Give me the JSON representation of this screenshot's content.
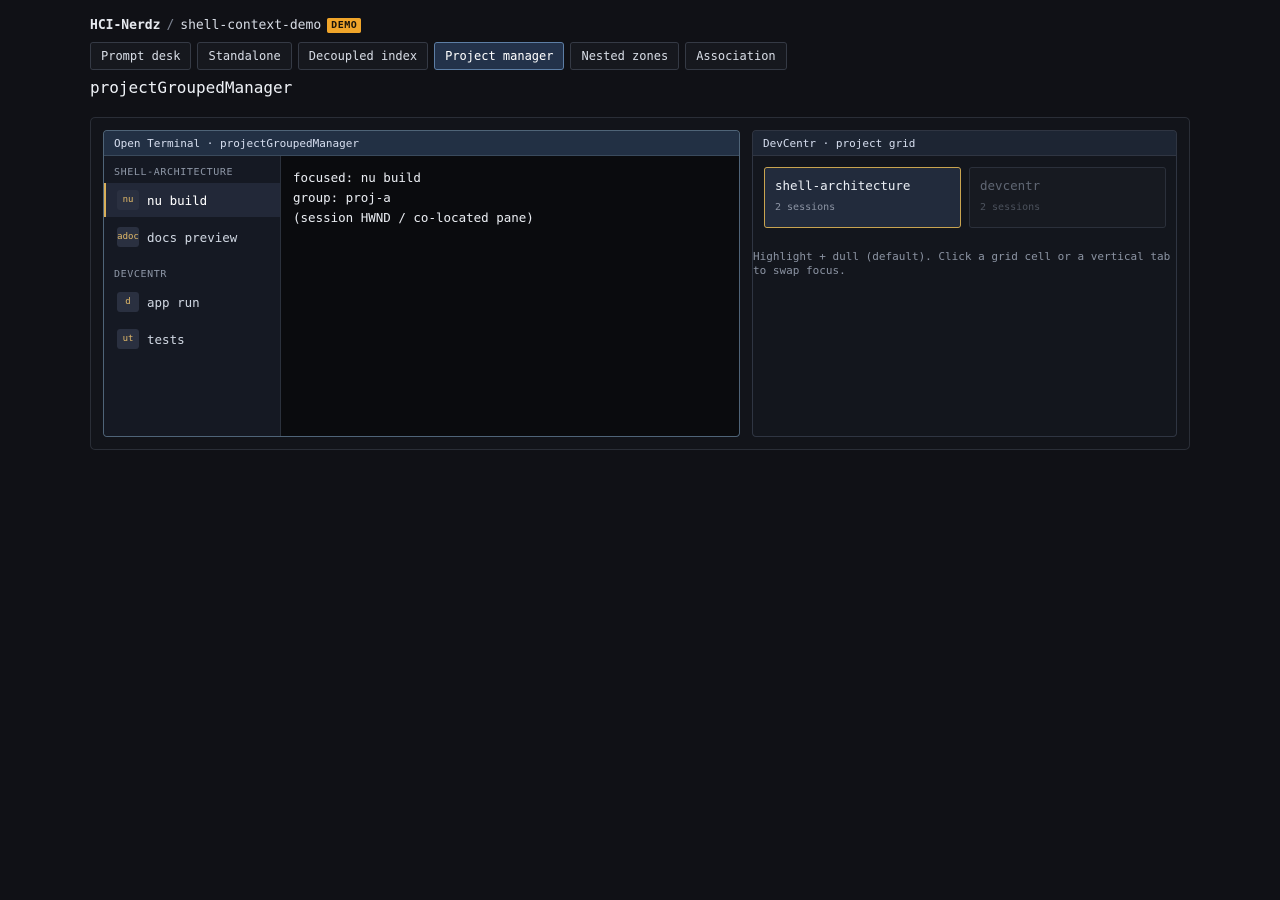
{
  "breadcrumb": {
    "org": "HCI-Nerdz",
    "separator": "/",
    "repo": "shell-context-demo",
    "badge": "DEMO"
  },
  "tabs": [
    {
      "label": "Prompt desk",
      "active": false
    },
    {
      "label": "Standalone",
      "active": false
    },
    {
      "label": "Decoupled index",
      "active": false
    },
    {
      "label": "Project manager",
      "active": true
    },
    {
      "label": "Nested zones",
      "active": false
    },
    {
      "label": "Association",
      "active": false
    }
  ],
  "page_title": "projectGroupedManager",
  "terminal": {
    "header": "Open Terminal · projectGroupedManager",
    "groups": [
      {
        "label": "SHELL-ARCHITECTURE",
        "items": [
          {
            "chip": "nu",
            "label": "nu build",
            "active": true
          },
          {
            "chip": "adoc",
            "label": "docs preview",
            "active": false
          }
        ]
      },
      {
        "label": "DEVCENTR",
        "items": [
          {
            "chip": "d",
            "label": "app run",
            "active": false
          },
          {
            "chip": "ut",
            "label": "tests",
            "active": false
          }
        ]
      }
    ],
    "output": [
      "focused: nu build",
      "group: proj-a",
      "(session HWND / co-located pane)"
    ]
  },
  "grid": {
    "header": "DevCentr · project grid",
    "cells": [
      {
        "name": "shell-architecture",
        "sub": "2 sessions",
        "active": true
      },
      {
        "name": "devcentr",
        "sub": "2 sessions",
        "active": false
      }
    ],
    "hint": "Highlight + dull (default). Click a grid cell or a vertical tab to swap focus."
  },
  "colors": {
    "background": "#101116",
    "badge": "#f0a52a",
    "accent_gold": "#d9b05a",
    "active_tab": "#23324a"
  }
}
